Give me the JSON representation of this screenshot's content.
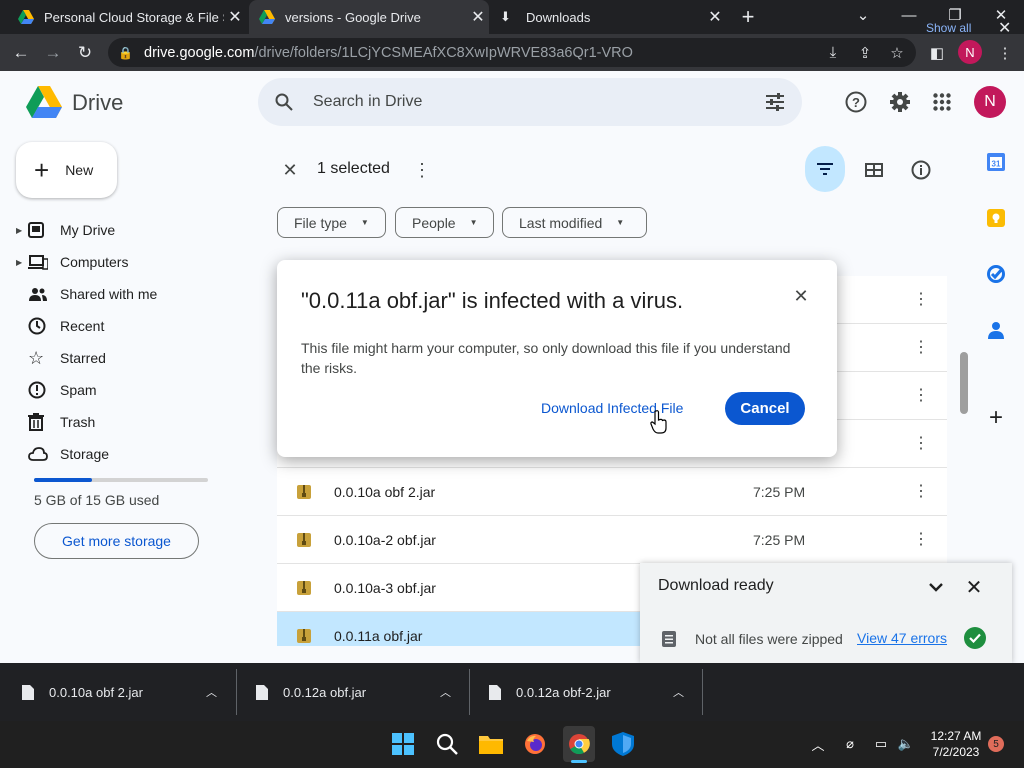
{
  "browser": {
    "tabs": [
      {
        "title": "Personal Cloud Storage & File Sh",
        "close": "✕"
      },
      {
        "title": "versions - Google Drive",
        "close": "✕"
      },
      {
        "title": "Downloads",
        "close": "✕"
      }
    ],
    "new_tab": "+",
    "url_host": "drive.google.com",
    "url_path": "/drive/folders/1LCjYCSMEAfXC8XwIpWRVE83a6Qr1-VRO",
    "profile_initial": "N"
  },
  "drive": {
    "logo_text": "Drive",
    "search_placeholder": "Search in Drive",
    "avatar_initial": "N",
    "new_label": "New",
    "nav": [
      {
        "label": "My Drive"
      },
      {
        "label": "Computers"
      },
      {
        "label": "Shared with me"
      },
      {
        "label": "Recent"
      },
      {
        "label": "Starred"
      },
      {
        "label": "Spam"
      },
      {
        "label": "Trash"
      },
      {
        "label": "Storage"
      }
    ],
    "storage_text": "5 GB of 15 GB used",
    "storage_fraction": 0.333,
    "get_more": "Get more storage",
    "selection_text": "1 selected",
    "filters": [
      "File type",
      "People",
      "Last modified"
    ],
    "files": [
      {
        "name": "",
        "time": ""
      },
      {
        "name": "",
        "time": ""
      },
      {
        "name": "",
        "time": ""
      },
      {
        "name": "",
        "time": ""
      },
      {
        "name": "0.0.10a obf 2.jar",
        "time": "7:25 PM"
      },
      {
        "name": "0.0.10a-2 obf.jar",
        "time": "7:25 PM"
      },
      {
        "name": "0.0.10a-3 obf.jar",
        "time": ""
      },
      {
        "name": "0.0.11a obf.jar",
        "time": ""
      }
    ]
  },
  "dialog": {
    "title": "\"0.0.11a obf.jar\" is infected with a virus.",
    "body": "This file might harm your computer, so only download this file if you understand the risks.",
    "download_label": "Download Infected File",
    "cancel_label": "Cancel"
  },
  "download_panel": {
    "title": "Download ready",
    "message": "Not all files were zipped",
    "link": "View 47 errors"
  },
  "shelf": {
    "items": [
      "0.0.10a obf 2.jar",
      "0.0.12a obf.jar",
      "0.0.12a obf-2.jar"
    ],
    "show_all": "Show all"
  },
  "taskbar": {
    "time": "12:27 AM",
    "date": "7/2/2023",
    "notifications": "5"
  }
}
